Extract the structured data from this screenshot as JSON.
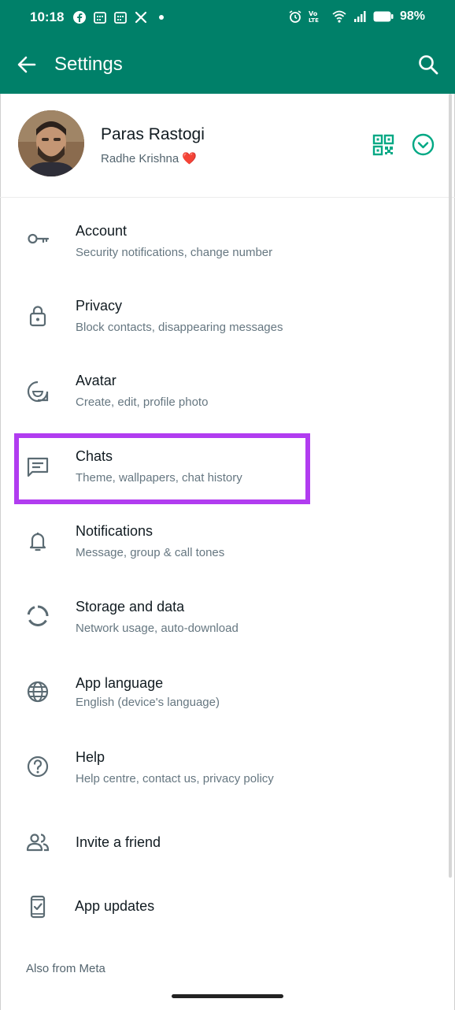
{
  "status_bar": {
    "time": "10:18",
    "battery": "98%"
  },
  "app_bar": {
    "title": "Settings"
  },
  "profile": {
    "name": "Paras Rastogi",
    "about": "Radhe Krishna ❤️"
  },
  "settings": [
    {
      "label": "Account",
      "sub": "Security notifications, change number",
      "icon": "key-icon"
    },
    {
      "label": "Privacy",
      "sub": "Block contacts, disappearing messages",
      "icon": "lock-icon"
    },
    {
      "label": "Avatar",
      "sub": "Create, edit, profile photo",
      "icon": "avatar-icon"
    },
    {
      "label": "Chats",
      "sub": "Theme, wallpapers, chat history",
      "icon": "chat-icon"
    },
    {
      "label": "Notifications",
      "sub": "Message, group & call tones",
      "icon": "bell-icon"
    },
    {
      "label": "Storage and data",
      "sub": "Network usage, auto-download",
      "icon": "storage-icon"
    },
    {
      "label": "App language",
      "sub": "English (device's language)",
      "icon": "globe-icon"
    },
    {
      "label": "Help",
      "sub": "Help centre, contact us, privacy policy",
      "icon": "help-icon"
    },
    {
      "label": "Invite a friend",
      "icon": "invite-icon"
    },
    {
      "label": "App updates",
      "icon": "phone-update-icon"
    }
  ],
  "footer": {
    "meta_label": "Also from Meta"
  },
  "colors": {
    "primary": "#008069",
    "highlight": "#b13cf0",
    "accent": "#00a884"
  }
}
